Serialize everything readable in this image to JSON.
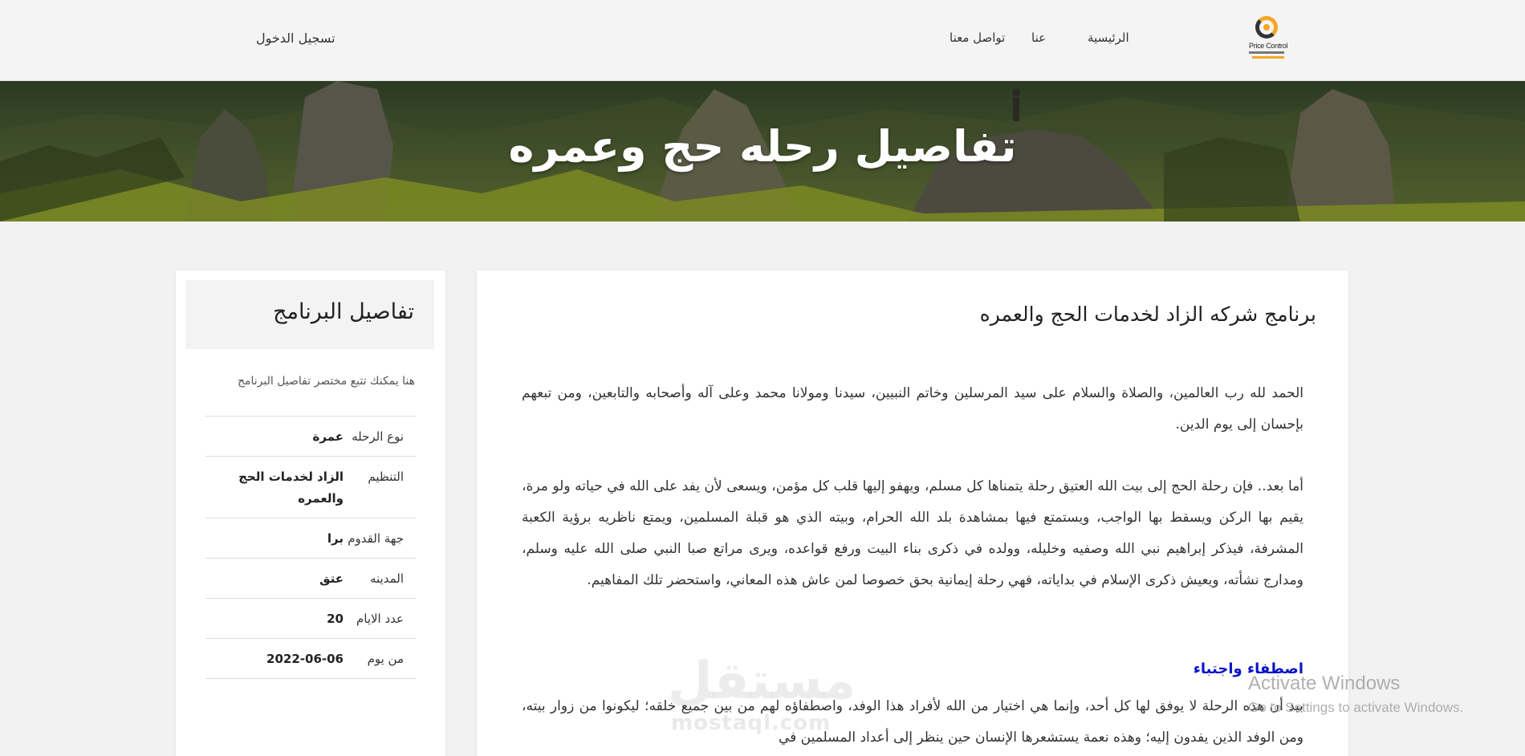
{
  "header": {
    "login_label": "تسجيل الدخول",
    "nav": {
      "home": "الرئيسية",
      "about": "عنا",
      "contact": "تواصل معنا"
    },
    "logo": {
      "name": "Price Control",
      "icon": "price-control-logo-icon"
    }
  },
  "hero": {
    "title": "تفاصيل رحله حج وعمره"
  },
  "main": {
    "title": "برنامج شركه الزاد لخدمات الحج والعمره",
    "paragraph1": "الحمد لله رب العالمين، والصلاة والسلام على سيد المرسلين وخاتم النبيين، سيدنا ومولانا محمد وعلى آله وأصحابه والتابعين، ومن تبعهم بإحسان إلى يوم الدين.",
    "paragraph2": "أما بعد.. فإن رحلة الحج إلى بيت الله العتيق رحلة يتمناها كل مسلم، ويهفو إليها قلب كل مؤمن، ويسعى لأن يفد على الله في حياته ولو مرة، يقيم بها الركن ويسقط بها الواجب، ويستمتع فيها بمشاهدة بلد الله الحرام، وبيته الذي هو قبلة المسلمين، ويمتع ناظريه برؤية الكعبة المشرفة، فيذكر إبراهيم نبي الله وصفيه وخليله، وولده في ذكرى بناء البيت ورفع قواعده، ويرى مراتع صبا النبي صلى الله عليه وسلم، ومدارج نشأته، ويعيش ذكرى الإسلام في بداياته، فهي رحلة إيمانية بحق خصوصا لمن عاش هذه المعاني، واستحضر تلك المفاهيم.",
    "section_heading": "اصطفاء واجتباء",
    "paragraph3": "بيد أن هذه الرحلة لا يوفق لها كل أحد، وإنما هي اختيار من الله لأفراد هذا الوفد، واصطفاؤه لهم من بين جميع خلقه؛ ليكونوا من زوار بيته، ومن الوفد الذين يفدون إليه؛ وهذه نعمة يستشعرها الإنسان حين ينظر إلى أعداد المسلمين في"
  },
  "sidebar": {
    "title": "تفاصيل البرنامج",
    "description": "هنا يمكنك تتبع مختصر تفاصيل البرنامج",
    "rows": [
      {
        "label": "نوع الرحله",
        "value": "عمرة"
      },
      {
        "label": "التنظيم",
        "value": "الزاد لخدمات الحج والعمره"
      },
      {
        "label": "جهة القدوم",
        "value": "برا"
      },
      {
        "label": "المدينه",
        "value": "عتق"
      },
      {
        "label": "عدد الايام",
        "value": "20"
      },
      {
        "label": "من يوم",
        "value": "2022-06-06"
      }
    ]
  },
  "overlay": {
    "watermark": "مستقل",
    "watermark_sub": "mostaql.com",
    "activate_title": "Activate Windows",
    "activate_sub": "Go to Settings to activate Windows."
  },
  "colors": {
    "accent": "#f5a623",
    "section_heading": "#0a14c8",
    "background": "#f2f2f2"
  }
}
